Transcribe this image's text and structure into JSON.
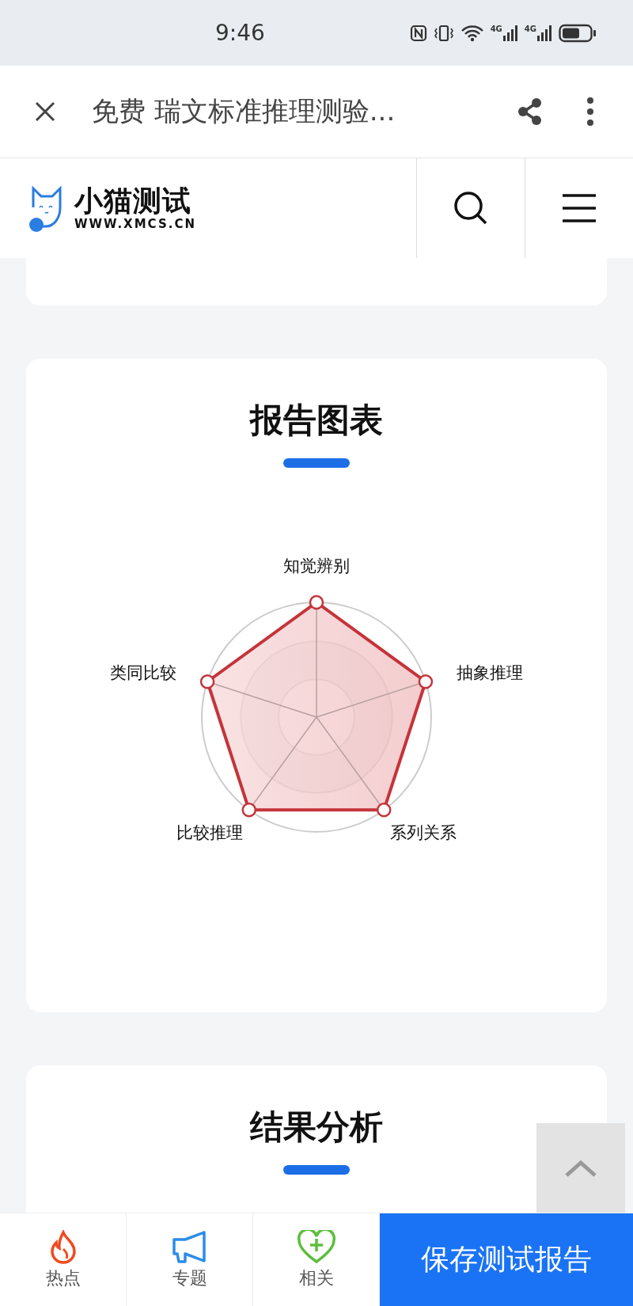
{
  "status_bar": {
    "time": "9:46",
    "network_labels": [
      "4G",
      "4G"
    ]
  },
  "browser_bar": {
    "title": "免费 瑞文标准推理测验..."
  },
  "site_header": {
    "logo_name": "小猫测试",
    "logo_url": "WWW.XMCS.CN"
  },
  "sections": [
    {
      "title": "报告图表",
      "axes": [
        "知觉辨别",
        "抽象推理",
        "系列关系",
        "比较推理",
        "类同比较"
      ]
    },
    {
      "title": "结果分析"
    }
  ],
  "bottom_bar": {
    "tabs": [
      {
        "label": "热点"
      },
      {
        "label": "专题"
      },
      {
        "label": "相关"
      }
    ],
    "save_button": "保存测试报告"
  }
}
